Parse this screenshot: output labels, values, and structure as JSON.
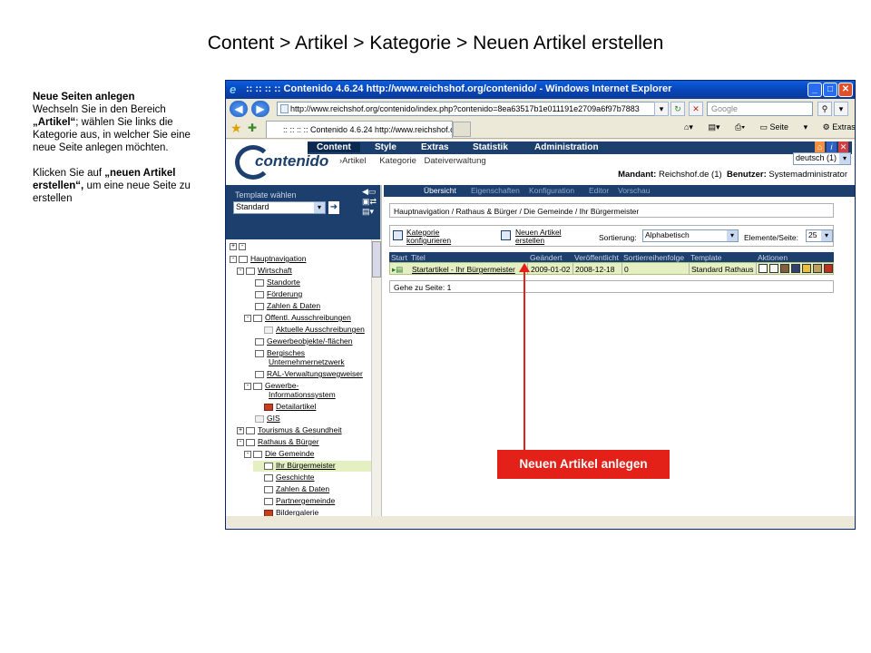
{
  "slide_title": "Content > Artikel > Kategorie > Neuen Artikel erstellen",
  "notes": {
    "heading": "Neue Seiten anlegen",
    "para1_pre": "Wechseln Sie in den Bereich ",
    "para1_bold": "„Artikel“",
    "para1_post": "; wählen Sie links die Kategorie aus, in welcher Sie eine neue Seite anlegen möchten.",
    "para2_pre": "Klicken Sie auf ",
    "para2_bold": "„neuen Artikel erstellen“,",
    "para2_post": " um eine neue Seite zu erstellen"
  },
  "browser": {
    "title": ":: :: :: :: Contenido 4.6.24 http://www.reichshof.org/contenido/ - Windows Internet Explorer",
    "address": "http://www.reichshof.org/contenido/index.php?contenido=8ea63517b1e011191e2709a6f97b7883",
    "search_placeholder": "Google",
    "tab_label": ":: :: :: :: Contenido 4.6.24 http://www.reichshof.org/...",
    "cmd_seite": "Seite",
    "cmd_extras": "Extras"
  },
  "cms": {
    "logo": "contenido",
    "mainnav": [
      "Content",
      "Style",
      "Extras",
      "Statistik",
      "Administration"
    ],
    "subnav": [
      "Artikel",
      "Kategorie",
      "Dateiverwaltung"
    ],
    "mandant_label": "Mandant:",
    "mandant_value": "Reichshof.de (1)",
    "benutzer_label": "Benutzer:",
    "benutzer_value": "Systemadministrator",
    "language": "deutsch (1)"
  },
  "left": {
    "template_label": "Template wählen",
    "template_value": "Standard",
    "tree": [
      {
        "label": "Hauptnavigation",
        "level": 0,
        "toggle": "-",
        "folder": "normal"
      },
      {
        "label": "Wirtschaft",
        "level": 1,
        "toggle": "-",
        "folder": "normal"
      },
      {
        "label": "Standorte",
        "level": 2,
        "toggle": "",
        "folder": "normal"
      },
      {
        "label": "Förderung",
        "level": 2,
        "toggle": "",
        "folder": "normal"
      },
      {
        "label": "Zahlen & Daten",
        "level": 2,
        "toggle": "",
        "folder": "normal"
      },
      {
        "label": "Öffentl. Ausschreibungen",
        "level": 2,
        "toggle": "-",
        "folder": "normal"
      },
      {
        "label": "Aktuelle Ausschreibungen",
        "level": 3,
        "toggle": "",
        "folder": "grey"
      },
      {
        "label": "Gewerbeobjekte/-flächen",
        "level": 2,
        "toggle": "",
        "folder": "normal"
      },
      {
        "label": "Bergisches",
        "level": 2,
        "toggle": "",
        "folder": "normal"
      },
      {
        "label": "Unternehmernetzwerk",
        "level": 2,
        "toggle": "",
        "folder": "none"
      },
      {
        "label": "RAL-Verwaltungswegweiser",
        "level": 2,
        "toggle": "",
        "folder": "normal"
      },
      {
        "label": "Gewerbe-",
        "level": 2,
        "toggle": "-",
        "folder": "normal"
      },
      {
        "label": "Informationssystem",
        "level": 2,
        "toggle": "",
        "folder": "none"
      },
      {
        "label": "Detailartikel",
        "level": 3,
        "toggle": "",
        "folder": "red"
      },
      {
        "label": "GIS",
        "level": 2,
        "toggle": "",
        "folder": "grey"
      },
      {
        "label": "Tourismus & Gesundheit",
        "level": 1,
        "toggle": "+",
        "folder": "normal"
      },
      {
        "label": "Rathaus & Bürger",
        "level": 1,
        "toggle": "-",
        "folder": "normal"
      },
      {
        "label": "Die Gemeinde",
        "level": 2,
        "toggle": "-",
        "folder": "normal"
      },
      {
        "label": "Ihr Bürgermeister",
        "level": 3,
        "toggle": "",
        "folder": "normal",
        "selected": true
      },
      {
        "label": "Geschichte",
        "level": 3,
        "toggle": "",
        "folder": "normal"
      },
      {
        "label": "Zahlen & Daten",
        "level": 3,
        "toggle": "",
        "folder": "normal"
      },
      {
        "label": "Partnergemeinde",
        "level": 3,
        "toggle": "",
        "folder": "normal"
      },
      {
        "label": "Bildergalerie",
        "level": 3,
        "toggle": "",
        "folder": "red"
      }
    ]
  },
  "right": {
    "tabs": [
      "Übersicht",
      "Eigenschaften",
      "Konfiguration",
      "Editor",
      "Vorschau"
    ],
    "breadcrumb": "Hauptnavigation / Rathaus & Bürger / Die Gemeinde / Ihr Bürgermeister",
    "kategorie_link_1": "Kategorie",
    "kategorie_link_2": "konfigurieren",
    "neu_link_1": "Neuen Artikel",
    "neu_link_2": "erstellen",
    "sort_label": "Sortierung:",
    "sort_value": "Alphabetisch",
    "per_page_label": "Elemente/Seite:",
    "per_page_value": "25",
    "columns": [
      "Start",
      "Titel",
      "Geändert",
      "Veröffentlicht",
      "Sortierreihenfolge",
      "Template",
      "Aktionen"
    ],
    "rows": [
      {
        "title": "Startartikel - Ihr Bürgermeister",
        "changed": "2009-01-02",
        "published": "2008-12-18",
        "sort": "0",
        "template": "Standard Rathaus"
      }
    ],
    "pager": "Gehe zu Seite:  1"
  },
  "callout": "Neuen Artikel anlegen",
  "colors": {
    "cms_navy": "#1c3f6e",
    "row_green": "#e4efc2",
    "callout_red": "#e32119"
  }
}
